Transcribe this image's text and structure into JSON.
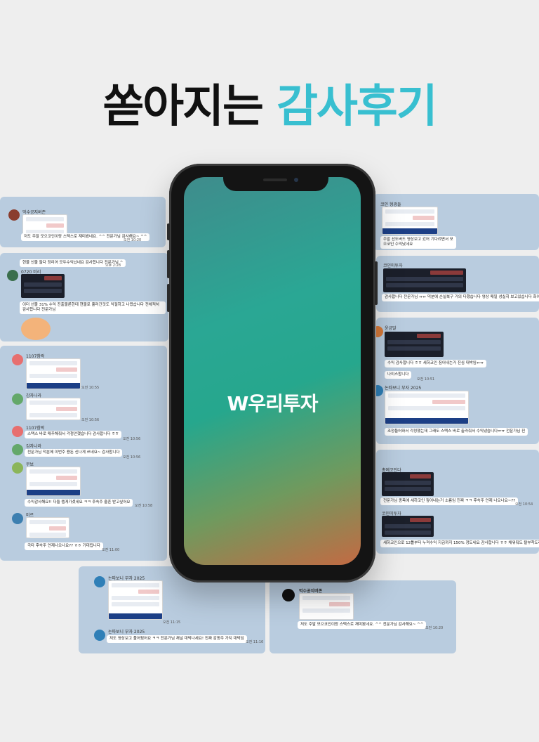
{
  "headline": {
    "part1": "쏟아지는",
    "part2": "감사후기"
  },
  "brand": {
    "logo": "W우리투자"
  },
  "colors": {
    "accent": "#38bfd0",
    "panel": "#b9ccdf",
    "headline_dark": "#111111",
    "white": "#ffffff"
  },
  "left_top_panel": {
    "name": "먹수공지버존",
    "bubble": "저도 주말 모으코인이랑 스택스로 재미봤네요. ^^ 전문가님 감사해요~ ^^",
    "time": "오전 10:20"
  },
  "left_mid_panel": {
    "bubble1": "현물 신물 들다 정리어 모두수익났네요 감사합니다 전문가님 ^",
    "time1": "오후 2:28",
    "name": "0720 미리",
    "bubble2": "이더 선물 31% 수익 진출물론한데 현물로 훌러간것도 익절하고 나왔습니다 전체적처 감사합니다 전문가님",
    "bubble3": "ㅠㅠ"
  },
  "left_bottom_panel": {
    "entries": [
      {
        "name": "1107참락",
        "time": "오전 10:55"
      },
      {
        "name": "감자나라",
        "time": "오전 10:56"
      },
      {
        "name": "1107참락",
        "bubble": "스택스 바로 매추해줘서 각청안했습니다 감사합니다 ㅎㅎ",
        "time": "오전 10:56"
      },
      {
        "name": "감자나라",
        "bubble": "전문가님 덕분에 이번주 용돈 신나게 쓰네요~ 감사합니다",
        "time": "오전 10:56"
      },
      {
        "name": "무보",
        "bubble": "수익감사해요!! 다들 렙게가셨네요 ㅋㅋ 후속주 줄흔 받고싶어요",
        "time": "오전 10:58"
      },
      {
        "name": "미르",
        "bubble": "극타 후속주 언제나오나요?? ㅎㅎ 기대됩니다",
        "time": "오전 11:00"
      }
    ]
  },
  "bottom_left_panel": {
    "name1": "논따보니 부자 2025",
    "time1": "오전 11:15",
    "name2": "논따보니 부자 2025",
    "bubble": "저도 영상보고 풀어뒀어요 ㅋㅋ 전문가님 채널 대박나세요! 진짜 감동주 가치 대박임",
    "time2": "오전 11:16"
  },
  "bottom_right_panel": {
    "name": "먹수공지버존",
    "bubble": "저도 주말 모으코인이랑 스택스로 재미봤네요. ^^ 전문가님 감사해요~ ^^",
    "time": "오전 10:20"
  },
  "right_top_panel": {
    "name": "코인 형광들",
    "bubble": "주말 선도버드 영상보고 갔어 기다려면서 모으코인 수익났네요",
    "time": ""
  },
  "right_mid_panel": {
    "name": "코인미투자",
    "bubble": "감사합니다 전문가님 ㅠㅠ 덕분에 손실복구 거의 다했습니다 영상 매일 성실히 보고있습니다 화이팅"
  },
  "right_lower_panel": {
    "name1": "윤금말",
    "bubble1": "수익 감사합니다 ㅎㅎ 세하코인 짚어내는거 진심 대박임ㅠㅠ",
    "bubble2": "나이스합니다",
    "time": "오전 10:51",
    "name2": "논따보니 부자 2025",
    "bubble3": "조정들어와서 각정했는데 그래도 스택스 바로 출라줘서 수익냈습니다ㅠㅠ 전문가님 진"
  },
  "right_bottom_panel": {
    "name1": "총예코인다",
    "bubble1": "전문가님 종목에 세하코인 짚어내는거 소름임 진짜 ㅋㅋ 후속주 언제 나오나요~??",
    "time": "오전 10:54",
    "name2": "코인미투자",
    "bubble2": "세하코인으로 12틀부터 누적수익 지금까지 150% 정도네요 감사합니다 ㅎㅎ 채워줘도 탈부착도레요"
  }
}
